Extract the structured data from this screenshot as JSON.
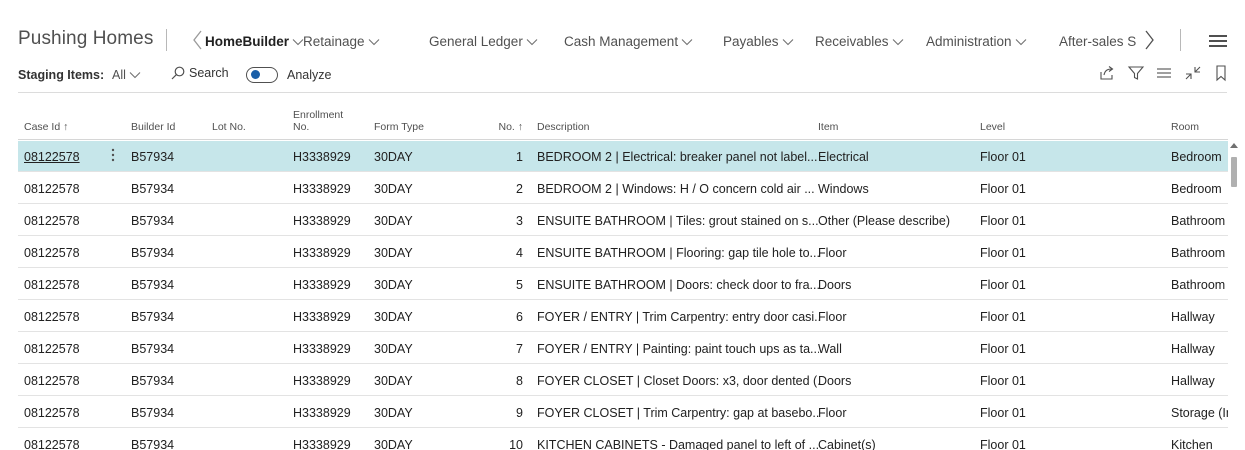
{
  "header": {
    "company": "Pushing Homes",
    "nav": [
      {
        "label": "HomeBuilder",
        "active": true
      },
      {
        "label": "Retainage",
        "active": false
      },
      {
        "label": "General Ledger",
        "active": false
      },
      {
        "label": "Cash Management",
        "active": false
      },
      {
        "label": "Payables",
        "active": false
      },
      {
        "label": "Receivables",
        "active": false
      },
      {
        "label": "Administration",
        "active": false
      },
      {
        "label": "After-sales S",
        "active": false
      }
    ]
  },
  "actionbar": {
    "staging_label": "Staging Items:",
    "filter_value": "All",
    "search_label": "Search",
    "analyze_label": "Analyze"
  },
  "table": {
    "columns": [
      "Case Id ↑",
      "Builder Id",
      "Lot No.",
      "Enrollment No.",
      "Form Type",
      "No. ↑",
      "Description",
      "Item",
      "Level",
      "Room"
    ],
    "enrollment_header": [
      "Enrollment",
      "No."
    ],
    "rows": [
      {
        "case_id": "08122578",
        "builder_id": "B57934",
        "lot_no": "",
        "enrollment_no": "H3338929",
        "form_type": "30DAY",
        "no": "1",
        "description": "BEDROOM 2 | Electrical: breaker panel not label...",
        "item": "Electrical",
        "level": "Floor 01",
        "room": "Bedroom"
      },
      {
        "case_id": "08122578",
        "builder_id": "B57934",
        "lot_no": "",
        "enrollment_no": "H3338929",
        "form_type": "30DAY",
        "no": "2",
        "description": "BEDROOM 2 | Windows: H / O concern cold air ...",
        "item": "Windows",
        "level": "Floor 01",
        "room": "Bedroom"
      },
      {
        "case_id": "08122578",
        "builder_id": "B57934",
        "lot_no": "",
        "enrollment_no": "H3338929",
        "form_type": "30DAY",
        "no": "3",
        "description": "ENSUITE BATHROOM | Tiles: grout stained on s...",
        "item": "Other (Please describe)",
        "level": "Floor 01",
        "room": "Bathroom"
      },
      {
        "case_id": "08122578",
        "builder_id": "B57934",
        "lot_no": "",
        "enrollment_no": "H3338929",
        "form_type": "30DAY",
        "no": "4",
        "description": "ENSUITE BATHROOM | Flooring: gap tile hole to...",
        "item": "Floor",
        "level": "Floor 01",
        "room": "Bathroom"
      },
      {
        "case_id": "08122578",
        "builder_id": "B57934",
        "lot_no": "",
        "enrollment_no": "H3338929",
        "form_type": "30DAY",
        "no": "5",
        "description": "ENSUITE BATHROOM | Doors: check door to fra...",
        "item": "Doors",
        "level": "Floor 01",
        "room": "Bathroom"
      },
      {
        "case_id": "08122578",
        "builder_id": "B57934",
        "lot_no": "",
        "enrollment_no": "H3338929",
        "form_type": "30DAY",
        "no": "6",
        "description": "FOYER / ENTRY | Trim Carpentry: entry door casi...",
        "item": "Floor",
        "level": "Floor 01",
        "room": "Hallway"
      },
      {
        "case_id": "08122578",
        "builder_id": "B57934",
        "lot_no": "",
        "enrollment_no": "H3338929",
        "form_type": "30DAY",
        "no": "7",
        "description": "FOYER / ENTRY | Painting: paint touch ups as ta...",
        "item": "Wall",
        "level": "Floor 01",
        "room": "Hallway"
      },
      {
        "case_id": "08122578",
        "builder_id": "B57934",
        "lot_no": "",
        "enrollment_no": "H3338929",
        "form_type": "30DAY",
        "no": "8",
        "description": "FOYER CLOSET | Closet Doors: x3, door dented (...",
        "item": "Doors",
        "level": "Floor 01",
        "room": "Hallway"
      },
      {
        "case_id": "08122578",
        "builder_id": "B57934",
        "lot_no": "",
        "enrollment_no": "H3338929",
        "form_type": "30DAY",
        "no": "9",
        "description": "FOYER CLOSET | Trim Carpentry: gap at basebo...",
        "item": "Floor",
        "level": "Floor 01",
        "room": "Storage (Interi"
      },
      {
        "case_id": "08122578",
        "builder_id": "B57934",
        "lot_no": "",
        "enrollment_no": "H3338929",
        "form_type": "30DAY",
        "no": "10",
        "description": "KITCHEN CABINETS - Damaged panel to left of ...",
        "item": "Cabinet(s)",
        "level": "Floor 01",
        "room": "Kitchen"
      }
    ]
  },
  "colors": {
    "selected_row": "#c6e6ea",
    "accent": "#1a5fa8"
  }
}
